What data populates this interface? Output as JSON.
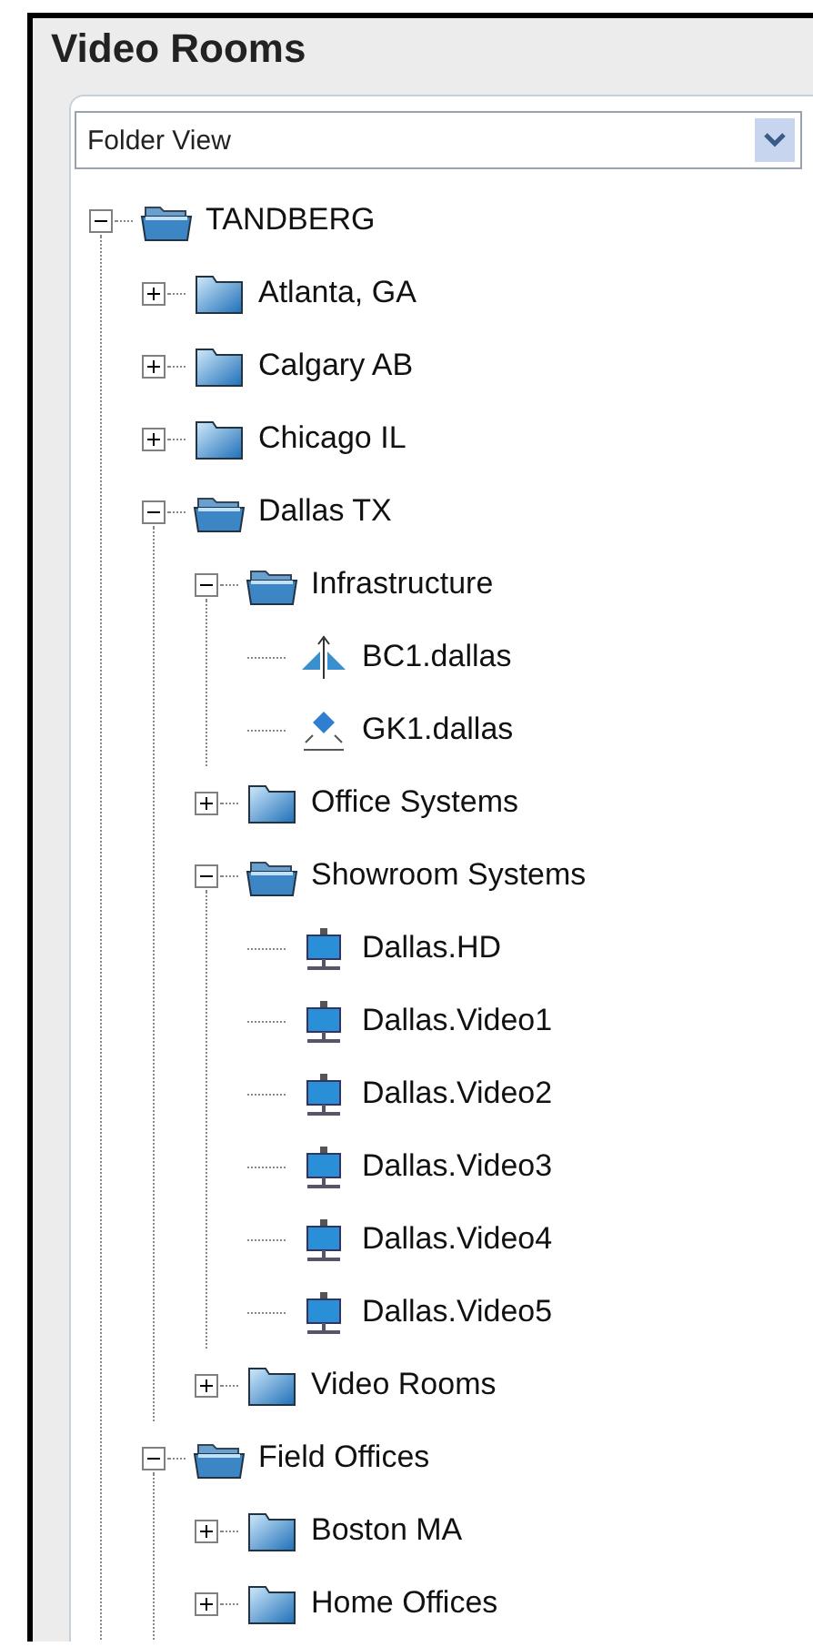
{
  "window": {
    "title": "Video Rooms"
  },
  "view_select": {
    "value": "Folder View"
  },
  "tree": [
    {
      "label": "TANDBERG",
      "kind": "folder",
      "expanded": true,
      "children": [
        {
          "label": "Atlanta, GA",
          "kind": "folder",
          "expanded": false
        },
        {
          "label": "Calgary AB",
          "kind": "folder",
          "expanded": false
        },
        {
          "label": "Chicago IL",
          "kind": "folder",
          "expanded": false
        },
        {
          "label": "Dallas TX",
          "kind": "folder",
          "expanded": true,
          "children": [
            {
              "label": "Infrastructure",
              "kind": "folder",
              "expanded": true,
              "children": [
                {
                  "label": "BC1.dallas",
                  "kind": "bridge"
                },
                {
                  "label": "GK1.dallas",
                  "kind": "gatekeeper"
                }
              ]
            },
            {
              "label": "Office Systems",
              "kind": "folder",
              "expanded": false
            },
            {
              "label": "Showroom Systems",
              "kind": "folder",
              "expanded": true,
              "children": [
                {
                  "label": "Dallas.HD",
                  "kind": "system"
                },
                {
                  "label": "Dallas.Video1",
                  "kind": "system"
                },
                {
                  "label": "Dallas.Video2",
                  "kind": "system"
                },
                {
                  "label": "Dallas.Video3",
                  "kind": "system"
                },
                {
                  "label": "Dallas.Video4",
                  "kind": "system"
                },
                {
                  "label": "Dallas.Video5",
                  "kind": "system"
                }
              ]
            },
            {
              "label": "Video Rooms",
              "kind": "folder",
              "expanded": false
            }
          ]
        },
        {
          "label": "Field Offices",
          "kind": "folder",
          "expanded": true,
          "children": [
            {
              "label": "Boston MA",
              "kind": "folder",
              "expanded": false
            },
            {
              "label": "Home Offices",
              "kind": "folder",
              "expanded": false
            }
          ]
        }
      ]
    }
  ]
}
